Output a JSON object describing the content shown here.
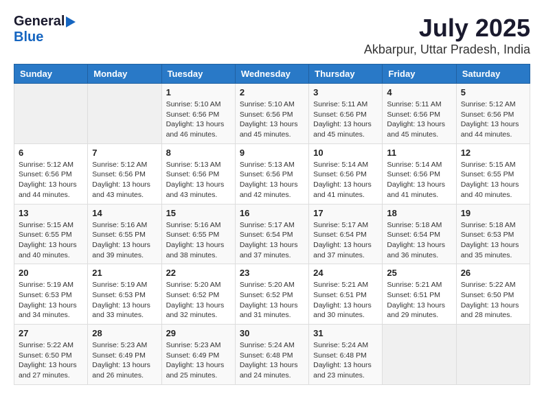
{
  "header": {
    "logo_general": "General",
    "logo_blue": "Blue",
    "title": "July 2025",
    "subtitle": "Akbarpur, Uttar Pradesh, India"
  },
  "calendar": {
    "headers": [
      "Sunday",
      "Monday",
      "Tuesday",
      "Wednesday",
      "Thursday",
      "Friday",
      "Saturday"
    ],
    "weeks": [
      [
        {
          "day": "",
          "info": ""
        },
        {
          "day": "",
          "info": ""
        },
        {
          "day": "1",
          "info": "Sunrise: 5:10 AM\nSunset: 6:56 PM\nDaylight: 13 hours and 46 minutes."
        },
        {
          "day": "2",
          "info": "Sunrise: 5:10 AM\nSunset: 6:56 PM\nDaylight: 13 hours and 45 minutes."
        },
        {
          "day": "3",
          "info": "Sunrise: 5:11 AM\nSunset: 6:56 PM\nDaylight: 13 hours and 45 minutes."
        },
        {
          "day": "4",
          "info": "Sunrise: 5:11 AM\nSunset: 6:56 PM\nDaylight: 13 hours and 45 minutes."
        },
        {
          "day": "5",
          "info": "Sunrise: 5:12 AM\nSunset: 6:56 PM\nDaylight: 13 hours and 44 minutes."
        }
      ],
      [
        {
          "day": "6",
          "info": "Sunrise: 5:12 AM\nSunset: 6:56 PM\nDaylight: 13 hours and 44 minutes."
        },
        {
          "day": "7",
          "info": "Sunrise: 5:12 AM\nSunset: 6:56 PM\nDaylight: 13 hours and 43 minutes."
        },
        {
          "day": "8",
          "info": "Sunrise: 5:13 AM\nSunset: 6:56 PM\nDaylight: 13 hours and 43 minutes."
        },
        {
          "day": "9",
          "info": "Sunrise: 5:13 AM\nSunset: 6:56 PM\nDaylight: 13 hours and 42 minutes."
        },
        {
          "day": "10",
          "info": "Sunrise: 5:14 AM\nSunset: 6:56 PM\nDaylight: 13 hours and 41 minutes."
        },
        {
          "day": "11",
          "info": "Sunrise: 5:14 AM\nSunset: 6:56 PM\nDaylight: 13 hours and 41 minutes."
        },
        {
          "day": "12",
          "info": "Sunrise: 5:15 AM\nSunset: 6:55 PM\nDaylight: 13 hours and 40 minutes."
        }
      ],
      [
        {
          "day": "13",
          "info": "Sunrise: 5:15 AM\nSunset: 6:55 PM\nDaylight: 13 hours and 40 minutes."
        },
        {
          "day": "14",
          "info": "Sunrise: 5:16 AM\nSunset: 6:55 PM\nDaylight: 13 hours and 39 minutes."
        },
        {
          "day": "15",
          "info": "Sunrise: 5:16 AM\nSunset: 6:55 PM\nDaylight: 13 hours and 38 minutes."
        },
        {
          "day": "16",
          "info": "Sunrise: 5:17 AM\nSunset: 6:54 PM\nDaylight: 13 hours and 37 minutes."
        },
        {
          "day": "17",
          "info": "Sunrise: 5:17 AM\nSunset: 6:54 PM\nDaylight: 13 hours and 37 minutes."
        },
        {
          "day": "18",
          "info": "Sunrise: 5:18 AM\nSunset: 6:54 PM\nDaylight: 13 hours and 36 minutes."
        },
        {
          "day": "19",
          "info": "Sunrise: 5:18 AM\nSunset: 6:53 PM\nDaylight: 13 hours and 35 minutes."
        }
      ],
      [
        {
          "day": "20",
          "info": "Sunrise: 5:19 AM\nSunset: 6:53 PM\nDaylight: 13 hours and 34 minutes."
        },
        {
          "day": "21",
          "info": "Sunrise: 5:19 AM\nSunset: 6:53 PM\nDaylight: 13 hours and 33 minutes."
        },
        {
          "day": "22",
          "info": "Sunrise: 5:20 AM\nSunset: 6:52 PM\nDaylight: 13 hours and 32 minutes."
        },
        {
          "day": "23",
          "info": "Sunrise: 5:20 AM\nSunset: 6:52 PM\nDaylight: 13 hours and 31 minutes."
        },
        {
          "day": "24",
          "info": "Sunrise: 5:21 AM\nSunset: 6:51 PM\nDaylight: 13 hours and 30 minutes."
        },
        {
          "day": "25",
          "info": "Sunrise: 5:21 AM\nSunset: 6:51 PM\nDaylight: 13 hours and 29 minutes."
        },
        {
          "day": "26",
          "info": "Sunrise: 5:22 AM\nSunset: 6:50 PM\nDaylight: 13 hours and 28 minutes."
        }
      ],
      [
        {
          "day": "27",
          "info": "Sunrise: 5:22 AM\nSunset: 6:50 PM\nDaylight: 13 hours and 27 minutes."
        },
        {
          "day": "28",
          "info": "Sunrise: 5:23 AM\nSunset: 6:49 PM\nDaylight: 13 hours and 26 minutes."
        },
        {
          "day": "29",
          "info": "Sunrise: 5:23 AM\nSunset: 6:49 PM\nDaylight: 13 hours and 25 minutes."
        },
        {
          "day": "30",
          "info": "Sunrise: 5:24 AM\nSunset: 6:48 PM\nDaylight: 13 hours and 24 minutes."
        },
        {
          "day": "31",
          "info": "Sunrise: 5:24 AM\nSunset: 6:48 PM\nDaylight: 13 hours and 23 minutes."
        },
        {
          "day": "",
          "info": ""
        },
        {
          "day": "",
          "info": ""
        }
      ]
    ]
  }
}
